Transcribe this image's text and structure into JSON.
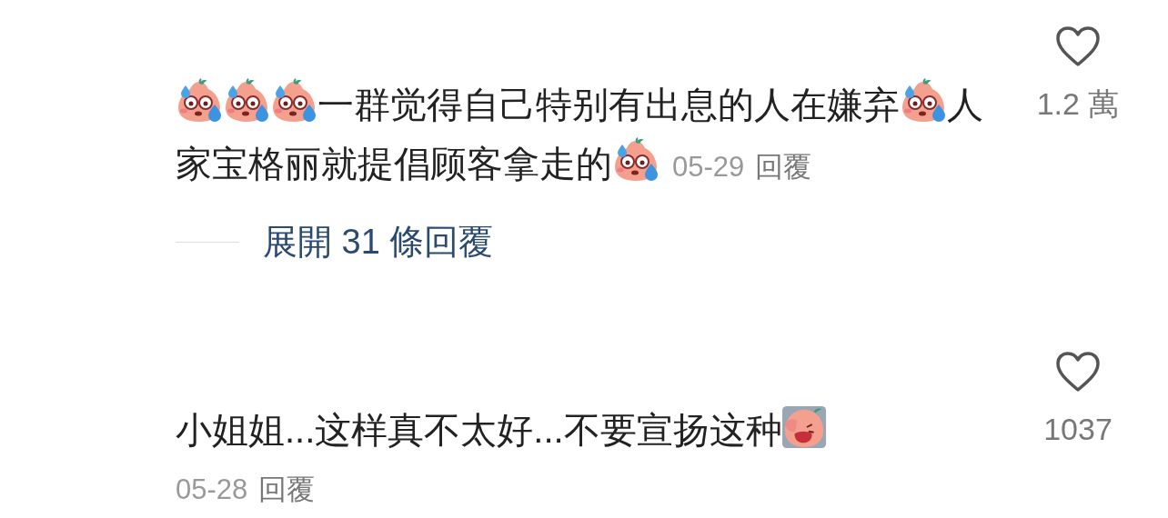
{
  "comments": [
    {
      "content": [
        {
          "kind": "sweat"
        },
        {
          "kind": "sweat"
        },
        {
          "kind": "sweat"
        },
        {
          "kind": "text",
          "text": "一群觉得自己特别有出息的人在嫌弃"
        },
        {
          "kind": "sweat"
        },
        {
          "kind": "text",
          "text": "人"
        },
        {
          "kind": "text",
          "text": "家宝格丽就提倡顾客拿走的"
        },
        {
          "kind": "sweat"
        }
      ],
      "date": "05-29",
      "reply": "回覆",
      "likes": "1.2 萬",
      "liked": false,
      "expand": "展開 31 條回覆",
      "date_inline": true
    },
    {
      "content": [
        {
          "kind": "text",
          "text": "小姐姐...这样真不太好...不要宣扬这种"
        },
        {
          "kind": "facepalm"
        }
      ],
      "date": "05-28",
      "reply": "回覆",
      "likes": "1037",
      "liked": false,
      "date_inline": false
    }
  ]
}
